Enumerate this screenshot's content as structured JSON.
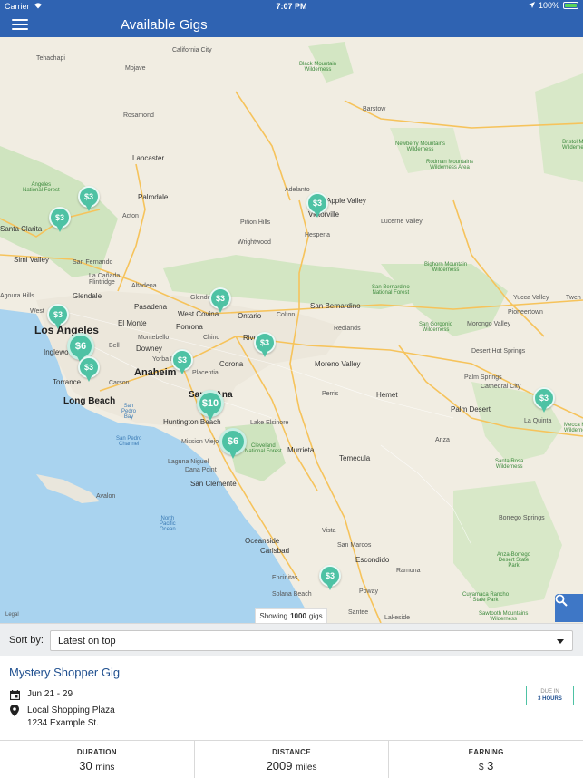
{
  "status": {
    "carrier": "Carrier",
    "time": "7:07 PM",
    "battery": "100%"
  },
  "nav": {
    "title": "Available Gigs"
  },
  "map": {
    "labels": {
      "tehachapi": "Tehachapi",
      "california_city": "California City",
      "mojave": "Mojave",
      "rosamond": "Rosamond",
      "lancaster": "Lancaster",
      "palmdale": "Palmdale",
      "acton": "Acton",
      "santa_clarita": "Santa Clarita",
      "simi_valley": "Simi Valley",
      "san_fernando": "San Fernando",
      "la_canada": "La Cañada\nFlintridge",
      "agoura_hills": "Agoura Hills",
      "glendale": "Glendale",
      "pasadena": "Pasadena",
      "altadena": "Altadena",
      "west_covina": "West Covina",
      "glendora": "Glendora",
      "ontario": "Ontario",
      "colton": "Colton",
      "san_bernardino": "San Bernardino",
      "redlands": "Redlands",
      "los_angeles": "Los Angeles",
      "el_monte": "El Monte",
      "pomona": "Pomona",
      "montebello": "Montebello",
      "chino": "Chino",
      "riverside": "Riverside",
      "inglewood": "Inglewood",
      "bell": "Bell",
      "downey": "Downey",
      "yorba_linda": "Yorba Linda",
      "placentia": "Placentia",
      "corona": "Corona",
      "moreno_valley": "Moreno Valley",
      "torrance": "Torrance",
      "carson": "Carson",
      "anaheim": "Anaheim",
      "long_beach": "Long Beach",
      "santa_ana": "Santa Ana",
      "huntington_beach": "Huntington Beach",
      "lake_elsinore": "Lake Elsinore",
      "perris": "Perris",
      "hemet": "Hemet",
      "mission_viejo": "Mission Viejo",
      "laguna_niguel": "Laguna Niguel",
      "dana_point": "Dana Point",
      "san_clemente": "San Clemente",
      "murrieta": "Murrieta",
      "temecula": "Temecula",
      "oceanside": "Oceanside",
      "carlsbad": "Carlsbad",
      "vista": "Vista",
      "san_marcos": "San Marcos",
      "escondido": "Escondido",
      "encinitas": "Encinitas",
      "solana_beach": "Solana Beach",
      "poway": "Poway",
      "santee": "Santee",
      "lakeside": "Lakeside",
      "ramona": "Ramona",
      "barstow": "Barstow",
      "adelanto": "Adelanto",
      "apple_valley": "Apple Valley",
      "victorville": "Victorville",
      "hesperia": "Hesperia",
      "pinon_hills": "Piñon Hills",
      "wrightwood": "Wrightwood",
      "lucerne_valley": "Lucerne Valley",
      "yucca_valley": "Yucca Valley",
      "twentynine": "Twen",
      "desert_hot_springs": "Desert Hot Springs",
      "palm_springs": "Palm Springs",
      "cathedral_city": "Cathedral City",
      "palm_desert": "Palm Desert",
      "la_quinta": "La Quinta",
      "morongo_valley": "Morongo Valley",
      "pioneertown": "Pioneertown",
      "anza": "Anza",
      "borrego_springs": "Borrego Springs",
      "avalon": "Avalon",
      "black_mountain": "Black Mountain\nWilderness",
      "newberry": "Newberry Mountains\nWilderness",
      "rodman": "Rodman Mountains\nWilderness Area",
      "bristol": "Bristol M\nWilderne",
      "angeles": "Angeles\nNational Forest",
      "bighorn": "Bighorn Mountain\nWilderness",
      "san_bernardino_nf": "San Bernardino\nNational Forest",
      "san_gorgonio": "San Gorgonio\nWilderness",
      "cleveland": "Cleveland\nNational Forest",
      "santa_rosa": "Santa Rosa\nWilderness",
      "mecca": "Mecca H\nWilderne",
      "anza_borrego": "Anza-Borrego\nDesert State\nPark",
      "cuyamaca": "Cuyamaca Rancho\nState Park",
      "sawtooth": "Sawtooth Mountains\nWilderness",
      "san_pedro_bay": "San\nPedro\nBay",
      "san_pedro_channel": "San Pedro\nChannel",
      "north_pacific": "North\nPacific\nOcean"
    },
    "pins": [
      {
        "label": "$3"
      },
      {
        "label": "$3"
      },
      {
        "label": "$3"
      },
      {
        "label": "$3"
      },
      {
        "label": "$3"
      },
      {
        "label": "$6"
      },
      {
        "label": "$3"
      },
      {
        "label": "$3"
      },
      {
        "label": "$3"
      },
      {
        "label": "$10"
      },
      {
        "label": "$6"
      },
      {
        "label": "$3"
      },
      {
        "label": "$3"
      }
    ],
    "showing_prefix": "Showing",
    "showing_count": "1000",
    "showing_suffix": "gigs",
    "legal": "Legal",
    "search_icon": "search-icon"
  },
  "sort": {
    "label": "Sort by:",
    "selected": "Latest on top"
  },
  "gig": {
    "title": "Mystery Shopper Gig",
    "dates": "Jun 21 - 29",
    "place": "Local Shopping Plaza",
    "street": "1234 Example St.",
    "due_label": "DUE IN",
    "due_value": "3",
    "due_unit": "HOURS"
  },
  "stats": {
    "duration_label": "DURATION",
    "duration_value": "30",
    "duration_unit": "mins",
    "distance_label": "DISTANCE",
    "distance_value": "2009",
    "distance_unit": "miles",
    "earning_label": "EARNING",
    "earning_currency": "$",
    "earning_value": "3"
  },
  "colors": {
    "brand": "#2f63b2",
    "pin": "#4ec2a4",
    "title": "#1f4f8f"
  }
}
